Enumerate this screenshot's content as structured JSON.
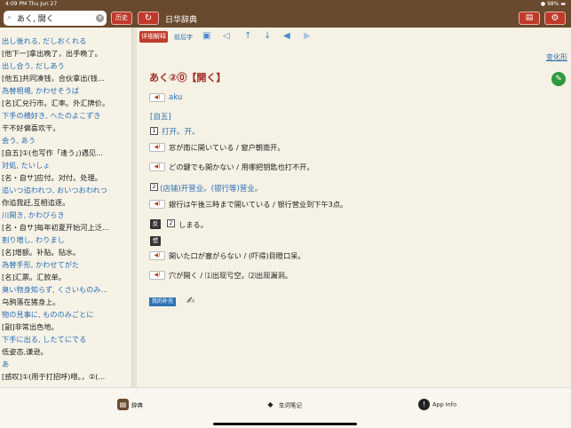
{
  "status": {
    "time_date": "4:09 PM   Thu Jun 27",
    "battery": "98%"
  },
  "nav": {
    "search_value": "あく, 開く",
    "history_label": "历史",
    "title": "日华辞典"
  },
  "list": [
    {
      "head": "出し後れる, だしおくれる",
      "desc": "[他下一]拿出晚了，出手晚了。"
    },
    {
      "head": "出し合う, だしあう",
      "desc": "[他五]共同凑钱，合伙拿出(钱..."
    },
    {
      "head": "為替相場, かわせそうば",
      "desc": "[名]汇兑行市。汇率。外汇牌价。"
    },
    {
      "head": "下手の横好き, へたのよこずき",
      "desc": "干不好偏喜欢干。"
    },
    {
      "head": "会う, あう",
      "desc": "[自五]①(也写作「逢う」)遇见..."
    },
    {
      "head": "対処, たいしょ",
      "desc": "[名・自サ]应付。对付。处理。"
    },
    {
      "head": "追いつ追われつ, おいつおわれつ",
      "desc": "你追我赶,互相追逐。"
    },
    {
      "head": "川開き, かわびらき",
      "desc": "[名・自サ]每年初夏开始河上泛..."
    },
    {
      "head": "割り増し, わりまし",
      "desc": "[名]增额。补贴。贴水。"
    },
    {
      "head": "為替手形, かわせてがた",
      "desc": "[名]汇票。汇款单。"
    },
    {
      "head": "臭い物身知らず, くさいものみ...",
      "desc": "乌鸦落在猪身上。"
    },
    {
      "head": "物の見事に, もののみごとに",
      "desc": "[副]非常出色地。"
    },
    {
      "head": "下手に出る, したてにでる",
      "desc": "低姿态,谦逊。"
    },
    {
      "head": "あ",
      "desc": "[感叹]①(用于打招呼)喂。，②(..."
    }
  ],
  "toolbar": {
    "detail_label": "详细解释",
    "prev_label": "前后字"
  },
  "entry": {
    "variant_label": "变化形",
    "headword": "あく②⓪【開く】",
    "romaji": "aku",
    "pos": "[自五]",
    "sense1_num": "1",
    "sense1": "打开。开。",
    "ex1": "窓が南に開いている / 窗户朝南开。",
    "ex2": "どの鍵でも開かない / 用哪把钥匙也打不开。",
    "sense2_num": "2",
    "sense2": "(店铺)开营业。(银行等)营业。",
    "ex3": "銀行は午後三時まで開いている / 银行营业到下午3点。",
    "antonym_tag": "反",
    "antonym_num": "2",
    "antonym": "しまる。",
    "idiom_tag": "惯",
    "ex4": "開いた口が塞がらない / (吓得)目瞪口呆。",
    "ex5": "穴が開く / ⑴出现亏空。⑵出现漏洞。",
    "my_supplement": "我的补充"
  },
  "tabs": [
    {
      "label": "辞典"
    },
    {
      "label": "生词笔记"
    },
    {
      "label": "App Info"
    }
  ]
}
